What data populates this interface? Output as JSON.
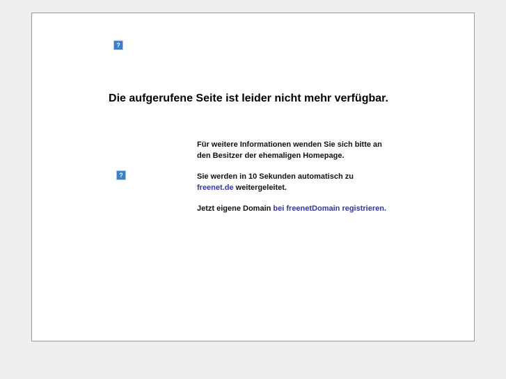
{
  "heading": "Die aufgerufene Seite ist leider nicht mehr verfügbar.",
  "icon_glyph": "?",
  "info_line1": "Für weitere Informationen wenden Sie sich bitte an",
  "info_line2": "den Besitzer der ehemaligen Homepage.",
  "redirect_text": "Sie werden in 10 Sekunden automatisch zu",
  "redirect_link": "freenet.de",
  "redirect_suffix": " weitergeleitet.",
  "domain_text": "Jetzt eigene Domain ",
  "domain_link": "bei freenetDomain registrieren."
}
